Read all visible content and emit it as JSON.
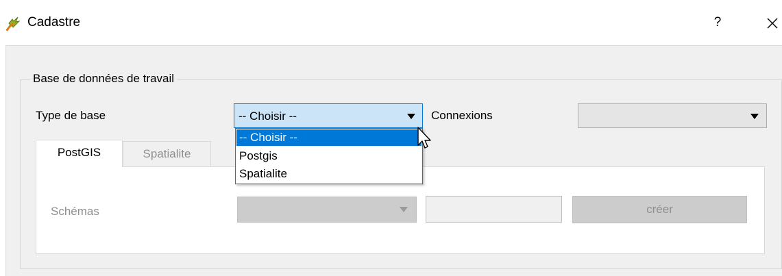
{
  "window": {
    "title": "Cadastre",
    "help_label": "?",
    "icon": "qgis-icon"
  },
  "group": {
    "title": "Base de données de travail"
  },
  "type_de_base": {
    "label": "Type de base",
    "selected": "-- Choisir --",
    "options": [
      "-- Choisir --",
      "Postgis",
      "Spatialite"
    ],
    "highlighted_index": 0
  },
  "connexions": {
    "label": "Connexions",
    "selected": ""
  },
  "tabs": [
    {
      "label": "PostGIS",
      "active": true
    },
    {
      "label": "Spatialite",
      "active": false
    }
  ],
  "postgis_panel": {
    "schemas_label": "Schémas",
    "schemas_value": "",
    "new_schema_value": "",
    "create_button_label": "créer"
  },
  "colors": {
    "accent": "#0078d7",
    "combo_focus_bg": "#cce4f7",
    "disabled_text": "#8f8f8f"
  }
}
